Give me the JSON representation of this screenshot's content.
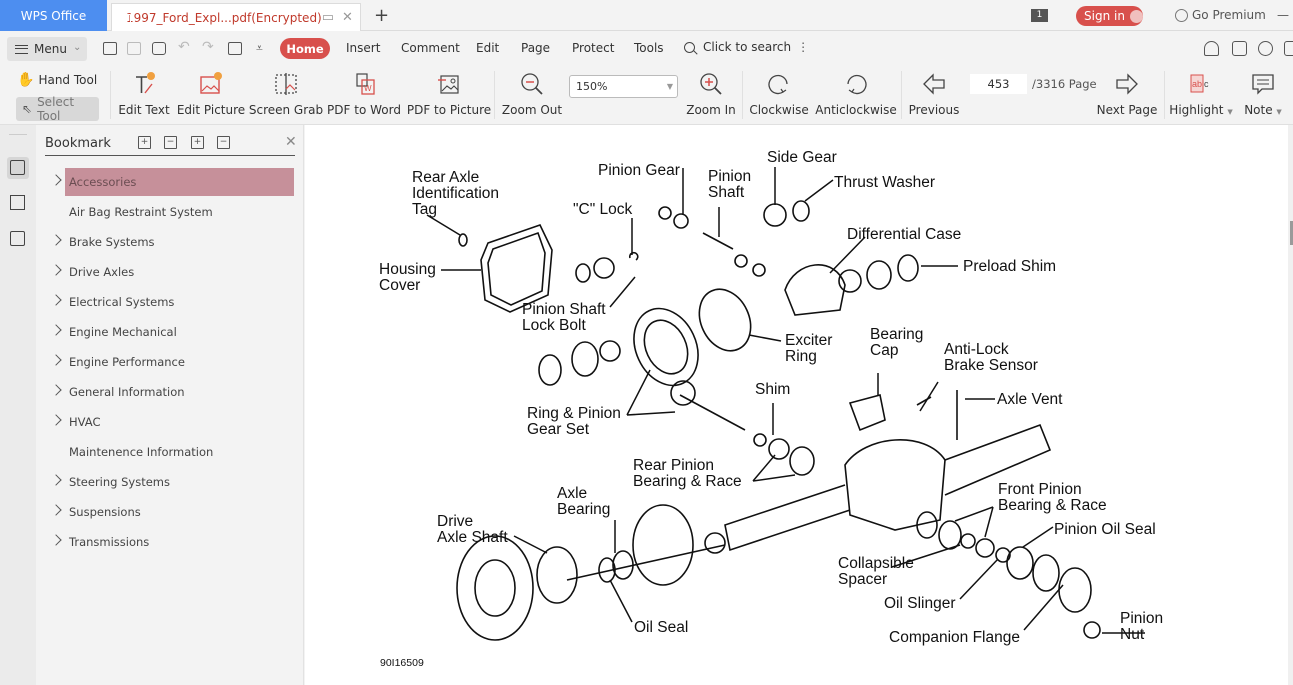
{
  "titlebar": {
    "app_tab": "WPS Office",
    "doc_tab": "1997_Ford_Expl...pdf(Encrypted)",
    "page_badge": "1",
    "sign_in": "Sign in",
    "go_premium": "Go Premium",
    "new_tab_symbol": "+",
    "close_symbol": "✕",
    "minimize_symbol": "—"
  },
  "menubar": {
    "menu_label": "Menu",
    "tabs": [
      "Home",
      "Insert",
      "Comment",
      "Edit",
      "Page",
      "Protect",
      "Tools"
    ],
    "active_tab": "Home",
    "search_placeholder": "Click to search",
    "more_symbol": "⋮",
    "quick_icons": [
      "open-folder-icon",
      "save-icon",
      "print-icon",
      "undo-icon",
      "redo-icon",
      "export-icon",
      "customize-icon"
    ],
    "right_icons": [
      "add-user-icon",
      "share-icon",
      "settings-icon",
      "more-icon"
    ]
  },
  "ribbon": {
    "hand_tool": "Hand Tool",
    "select_tool": "Select Tool",
    "buttons": {
      "edit_text": "Edit Text",
      "edit_picture": "Edit Picture",
      "screen_grab": "Screen Grab",
      "pdf_to_word": "PDF to Word",
      "pdf_to_picture": "PDF to Picture",
      "zoom_out": "Zoom Out",
      "zoom_in": "Zoom In",
      "clockwise": "Clockwise",
      "anticlockwise": "Anticlockwise",
      "previous": "Previous",
      "next_page": "Next Page",
      "highlight": "Highlight",
      "note": "Note"
    },
    "zoom_level": "150%",
    "current_page": "453",
    "total_pages": "/3316 Page",
    "accent_color": "#d8504c"
  },
  "sidebar": {
    "strip_icons": [
      "bookmark-list-icon",
      "thumbnail-icon",
      "attachment-icon"
    ],
    "title": "Bookmark",
    "tool_icons": [
      "expand-all-icon",
      "collapse-all-icon",
      "add-bookmark-icon",
      "delete-bookmark-icon"
    ],
    "close_symbol": "✕",
    "items": [
      {
        "label": "Accessories",
        "expandable": true,
        "selected": true
      },
      {
        "label": "Air Bag Restraint System",
        "expandable": false,
        "selected": false
      },
      {
        "label": "Brake Systems",
        "expandable": true,
        "selected": false
      },
      {
        "label": "Drive Axles",
        "expandable": true,
        "selected": false
      },
      {
        "label": "Electrical Systems",
        "expandable": true,
        "selected": false
      },
      {
        "label": "Engine Mechanical",
        "expandable": true,
        "selected": false
      },
      {
        "label": "Engine Performance",
        "expandable": true,
        "selected": false
      },
      {
        "label": "General Information",
        "expandable": true,
        "selected": false
      },
      {
        "label": "HVAC",
        "expandable": true,
        "selected": false
      },
      {
        "label": "Maintenence Information",
        "expandable": false,
        "selected": false
      },
      {
        "label": "Steering Systems",
        "expandable": true,
        "selected": false
      },
      {
        "label": "Suspensions",
        "expandable": true,
        "selected": false
      },
      {
        "label": "Transmissions",
        "expandable": true,
        "selected": false
      }
    ]
  },
  "document": {
    "figure_id": "90I16509",
    "labels": {
      "rear_axle_tag": [
        "Rear Axle",
        "Identification",
        "Tag"
      ],
      "housing_cover": [
        "Housing",
        "Cover"
      ],
      "c_lock": [
        "\"C\" Lock"
      ],
      "pinion_gear": [
        "Pinion Gear"
      ],
      "pinion_shaft": [
        "Pinion",
        "Shaft"
      ],
      "side_gear": [
        "Side Gear"
      ],
      "thrust_washer": [
        "Thrust Washer"
      ],
      "differential_case": [
        "Differential Case"
      ],
      "preload_shim": [
        "Preload Shim"
      ],
      "pinion_shaft_lock_bolt": [
        "Pinion Shaft",
        "Lock Bolt"
      ],
      "exciter_ring": [
        "Exciter",
        "Ring"
      ],
      "bearing_cap": [
        "Bearing",
        "Cap"
      ],
      "abs_sensor": [
        "Anti-Lock",
        "Brake Sensor"
      ],
      "axle_vent": [
        "Axle Vent"
      ],
      "shim": [
        "Shim"
      ],
      "ring_pinion": [
        "Ring & Pinion",
        "Gear Set"
      ],
      "rear_pinion_bearing": [
        "Rear Pinion",
        "Bearing & Race"
      ],
      "front_pinion_bearing": [
        "Front Pinion",
        "Bearing & Race"
      ],
      "pinion_oil_seal": [
        "Pinion Oil Seal"
      ],
      "axle_bearing": [
        "Axle",
        "Bearing"
      ],
      "drive_axle_shaft": [
        "Drive",
        "Axle Shaft"
      ],
      "collapsible_spacer": [
        "Collapsible",
        "Spacer"
      ],
      "oil_slinger": [
        "Oil Slinger"
      ],
      "oil_seal": [
        "Oil Seal"
      ],
      "companion_flange": [
        "Companion Flange"
      ],
      "pinion_nut": [
        "Pinion",
        "Nut"
      ]
    }
  }
}
